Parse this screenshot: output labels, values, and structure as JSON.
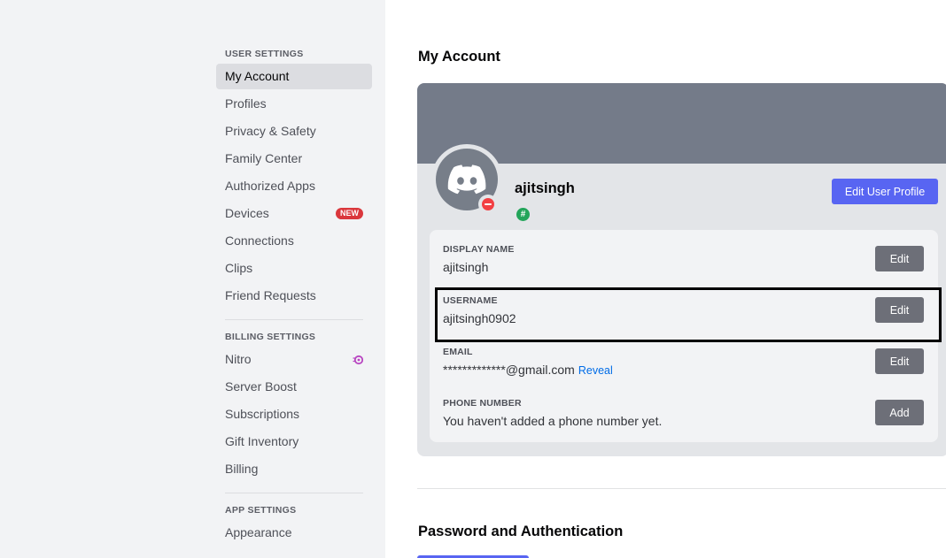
{
  "sidebar": {
    "user_settings": {
      "header": "USER SETTINGS",
      "items": [
        {
          "label": "My Account"
        },
        {
          "label": "Profiles"
        },
        {
          "label": "Privacy & Safety"
        },
        {
          "label": "Family Center"
        },
        {
          "label": "Authorized Apps"
        },
        {
          "label": "Devices",
          "badge": "NEW"
        },
        {
          "label": "Connections"
        },
        {
          "label": "Clips"
        },
        {
          "label": "Friend Requests"
        }
      ]
    },
    "billing_settings": {
      "header": "BILLING SETTINGS",
      "items": [
        {
          "label": "Nitro",
          "icon": "nitro-icon"
        },
        {
          "label": "Server Boost"
        },
        {
          "label": "Subscriptions"
        },
        {
          "label": "Gift Inventory"
        },
        {
          "label": "Billing"
        }
      ]
    },
    "app_settings": {
      "header": "APP SETTINGS",
      "items": [
        {
          "label": "Appearance"
        }
      ]
    }
  },
  "main": {
    "title": "My Account",
    "profile": {
      "username": "ajitsingh",
      "tag_symbol": "#",
      "edit_profile_label": "Edit User Profile",
      "status": "do-not-disturb"
    },
    "fields": [
      {
        "label": "DISPLAY NAME",
        "value": "ajitsingh",
        "button": "Edit"
      },
      {
        "label": "USERNAME",
        "value": "ajitsingh0902",
        "button": "Edit"
      },
      {
        "label": "EMAIL",
        "value": "*************@gmail.com",
        "link": "Reveal",
        "button": "Edit"
      },
      {
        "label": "PHONE NUMBER",
        "value": "You haven't added a phone number yet.",
        "button": "Add"
      }
    ],
    "section_title": "Password and Authentication"
  },
  "colors": {
    "accent": "#5865f2",
    "banner": "#747b89",
    "badge_new": "#da373c",
    "status_dnd": "#f23f43",
    "tag_green": "#23a55a",
    "link": "#006ce7"
  }
}
